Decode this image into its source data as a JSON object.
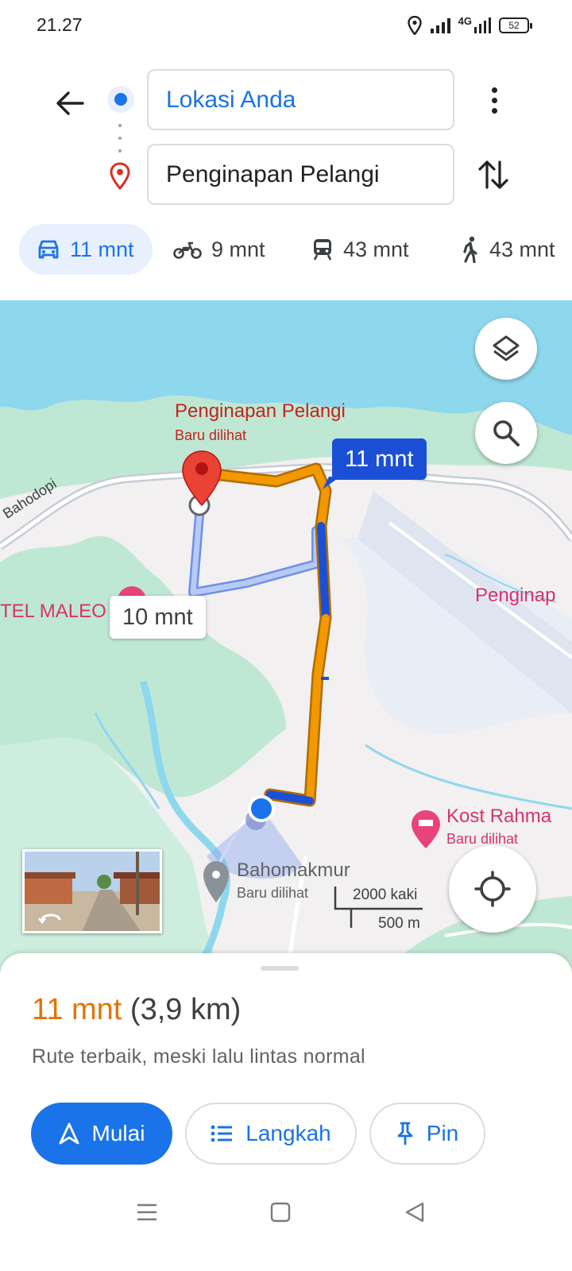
{
  "status_bar": {
    "time": "21.27",
    "network": "4G",
    "battery": "52"
  },
  "directions": {
    "origin": "Lokasi Anda",
    "destination": "Penginapan Pelangi"
  },
  "modes": [
    {
      "icon": "car-icon",
      "label": "11 mnt",
      "active": true
    },
    {
      "icon": "motorcycle-icon",
      "label": "9 mnt",
      "active": false
    },
    {
      "icon": "train-icon",
      "label": "43 mnt",
      "active": false
    },
    {
      "icon": "walk-icon",
      "label": "43 mnt",
      "active": false
    }
  ],
  "map": {
    "destination_name": "Penginapan Pelangi",
    "destination_sub": "Baru dilihat",
    "route_time": "11 mnt",
    "alt_route_time": "10 mnt",
    "road_label": "Bahodopi",
    "hotel_label": "TEL MALEO",
    "poi_right": "Penginap",
    "poi_kost": "Kost Rahma",
    "poi_kost_sub": "Baru dilihat",
    "poi_bahomakmur": "Bahomakmur",
    "poi_bahomakmur_sub": "Baru dilihat",
    "scale_imperial": "2000 kaki",
    "scale_metric": "500 m",
    "colors": {
      "water": "#8ed8ee",
      "green": "#bfe8d4",
      "land": "#f2f0f0",
      "route": "#f29900",
      "traffic": "#1a4fd6",
      "alt_route": "#9fb8f0"
    }
  },
  "sheet": {
    "duration": "11 mnt",
    "distance": "(3,9 km)",
    "description": "Rute terbaik, meski lalu lintas normal",
    "start_label": "Mulai",
    "steps_label": "Langkah",
    "pin_label": "Pin"
  },
  "accent": "#1a73e8"
}
